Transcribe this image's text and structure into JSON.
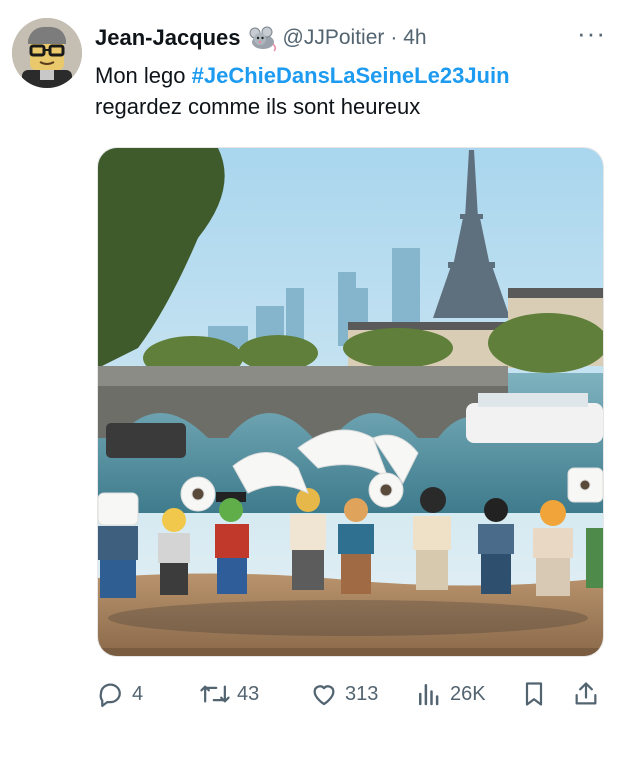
{
  "tweet": {
    "author_name": "Jean-Jacques",
    "handle": "@JJPoitier",
    "time": "· 4h",
    "more": "···",
    "text_line1_prefix": "Mon lego ",
    "hashtag": "#JeChieDansLaSeineLe23Juin",
    "text_line2": "regardez comme ils sont heureux",
    "image_alt": "Lego minifigures holding toilet paper rolls on the bank of the Seine, with a bridge, boat and the Eiffel Tower in the background"
  },
  "actions": {
    "replies": "4",
    "retweets": "43",
    "likes": "313",
    "views": "26K"
  },
  "icons": {
    "badge": "rat-badge-icon",
    "reply": "reply-icon",
    "retweet": "retweet-icon",
    "like": "heart-icon",
    "views": "views-icon",
    "bookmark": "bookmark-icon",
    "share": "share-icon"
  },
  "colors": {
    "accent": "#1d9bf0",
    "secondary_text": "#536471",
    "text": "#0f1419"
  }
}
